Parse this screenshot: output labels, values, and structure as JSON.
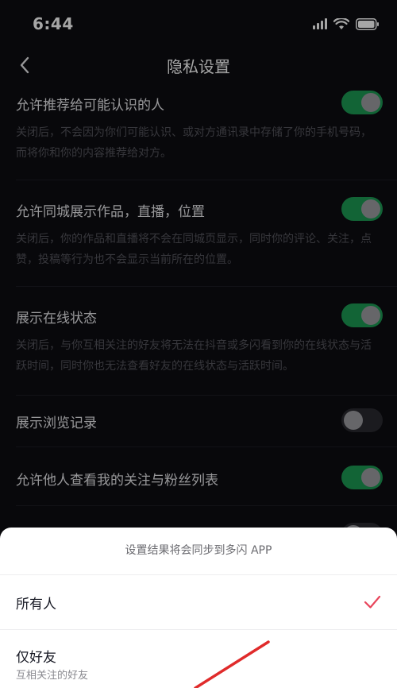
{
  "status_bar": {
    "time": "6:44"
  },
  "nav": {
    "title": "隐私设置"
  },
  "settings": [
    {
      "title": "允许推荐给可能认识的人",
      "enabled": true,
      "description": "关闭后，不会因为你们可能认识、或对方通讯录中存储了你的手机号码，而将你和你的内容推荐给对方。"
    },
    {
      "title": "允许同城展示作品，直播，位置",
      "enabled": true,
      "description": "关闭后，你的作品和直播将不会在同城页显示，同时你的评论、关注，点赞，投稿等行为也不会显示当前所在的位置。"
    },
    {
      "title": "展示在线状态",
      "enabled": true,
      "description": "关闭后，与你互相关注的好友将无法在抖音或多闪看到你的在线状态与活跃时间，同时你也无法查看好友的在线状态与活跃时间。"
    },
    {
      "title": "展示浏览记录",
      "enabled": false
    },
    {
      "title": "允许他人查看我的关注与粉丝列表",
      "enabled": true
    },
    {
      "enabled": false
    }
  ],
  "sheet": {
    "header": "设置结果将会同步到多闪 APP",
    "options": [
      {
        "label": "所有人",
        "selected": true
      },
      {
        "label": "仅好友",
        "sublabel": "互相关注的好友",
        "selected": false
      }
    ]
  },
  "colors": {
    "toggle_on": "#1c9a54",
    "check": "#e8445a",
    "annotation": "#e02b2b"
  }
}
